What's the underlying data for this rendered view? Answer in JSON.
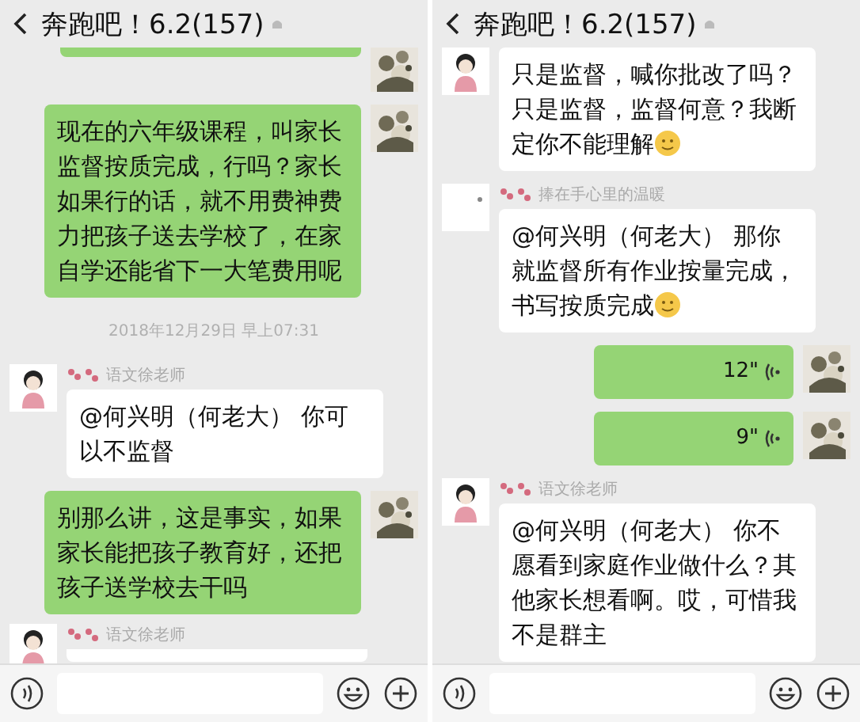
{
  "panels": [
    {
      "title": "奔跑吧！6.2(157)",
      "messages": [
        {
          "kind": "sent_stub"
        },
        {
          "kind": "sent_text",
          "text": "现在的六年级课程，叫家长监督按质完成，行吗？家长如果行的话，就不用费神费力把孩子送去学校了，在家自学还能省下一大笔费用呢"
        },
        {
          "kind": "time",
          "text": "2018年12月29日 早上07:31"
        },
        {
          "kind": "received_text",
          "blank_avatar": false,
          "sender": "语文徐老师",
          "text": "@何兴明（何老大） 你可以不监督"
        },
        {
          "kind": "sent_text",
          "text": "别那么讲，这是事实，如果家长能把孩子教育好，还把孩子送学校去干吗"
        },
        {
          "kind": "received_stub",
          "blank_avatar": false,
          "sender": "语文徐老师"
        }
      ]
    },
    {
      "title": "奔跑吧！6.2(157)",
      "messages": [
        {
          "kind": "received_text",
          "blank_avatar": false,
          "text": "只是监督，喊你批改了吗？只是监督，监督何意？我断定你不能理解",
          "emoji": true
        },
        {
          "kind": "received_text",
          "blank_avatar": true,
          "sender": "捧在手心里的温暖",
          "text": "@何兴明（何老大） 那你就监督所有作业按量完成，书写按质完成",
          "emoji": true
        },
        {
          "kind": "sent_voice",
          "text": "12\""
        },
        {
          "kind": "sent_voice",
          "text": "9\""
        },
        {
          "kind": "received_text",
          "blank_avatar": false,
          "sender": "语文徐老师",
          "text": "@何兴明（何老大） 你不愿看到家庭作业做什么？其他家长想看啊。哎，可惜我不是群主"
        }
      ]
    }
  ]
}
